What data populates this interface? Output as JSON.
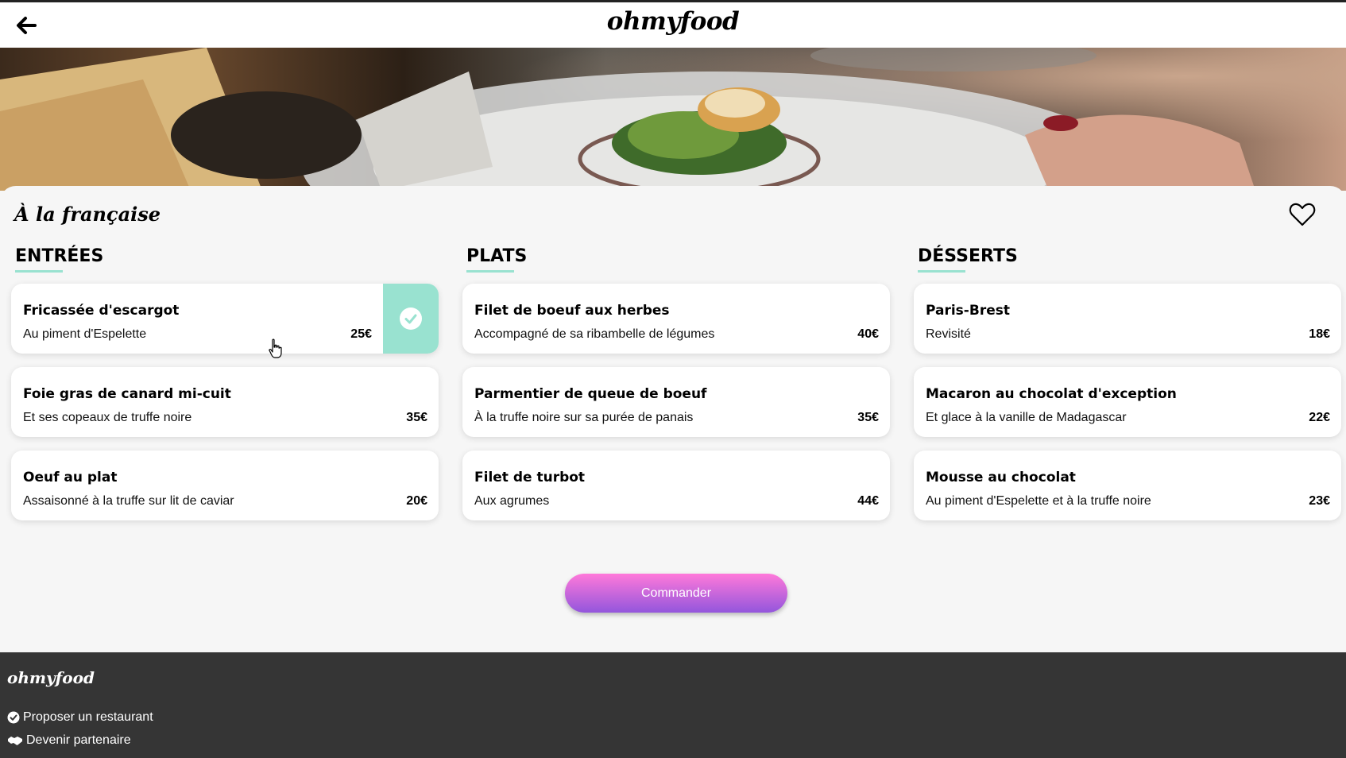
{
  "header": {
    "logo": "ohmyfood",
    "back_icon": "arrow-left-icon"
  },
  "restaurant": {
    "title": "À la française",
    "favorite_icon": "heart-icon"
  },
  "menu": {
    "columns": [
      {
        "heading": "ENTRÉES",
        "items": [
          {
            "name": "Fricassée d'escargot",
            "description": "Au piment d'Espelette",
            "price": "25€",
            "selected": true
          },
          {
            "name": "Foie gras de canard mi-cuit",
            "description": "Et ses copeaux de truffe noire",
            "price": "35€"
          },
          {
            "name": "Oeuf au plat",
            "description": "Assaisonné à la truffe sur lit de caviar",
            "price": "20€"
          }
        ]
      },
      {
        "heading": "PLATS",
        "items": [
          {
            "name": "Filet de boeuf aux herbes",
            "description": "Accompagné de sa ribambelle de légumes",
            "price": "40€"
          },
          {
            "name": "Parmentier de queue de boeuf",
            "description": "À la truffe noire sur sa purée de panais",
            "price": "35€"
          },
          {
            "name": "Filet de turbot",
            "description": "Aux agrumes",
            "price": "44€"
          }
        ]
      },
      {
        "heading": "DÉSSERTS",
        "items": [
          {
            "name": "Paris-Brest",
            "description": "Revisité",
            "price": "18€"
          },
          {
            "name": "Macaron au chocolat d'exception",
            "description": "Et glace à la vanille de Madagascar",
            "price": "22€"
          },
          {
            "name": "Mousse au chocolat",
            "description": "Au piment d'Espelette et à la truffe noire",
            "price": "23€"
          }
        ]
      }
    ]
  },
  "order_button": {
    "label": "Commander"
  },
  "footer": {
    "logo": "ohmyfood",
    "links": [
      {
        "label": "Proposer un restaurant",
        "icon": "check-circle-icon"
      },
      {
        "label": "Devenir partenaire",
        "icon": "handshake-icon"
      }
    ]
  },
  "colors": {
    "accent": "#99e2d0",
    "button_top": "#ff79da",
    "button_bottom": "#9356dc",
    "footer_bg": "#353535"
  }
}
